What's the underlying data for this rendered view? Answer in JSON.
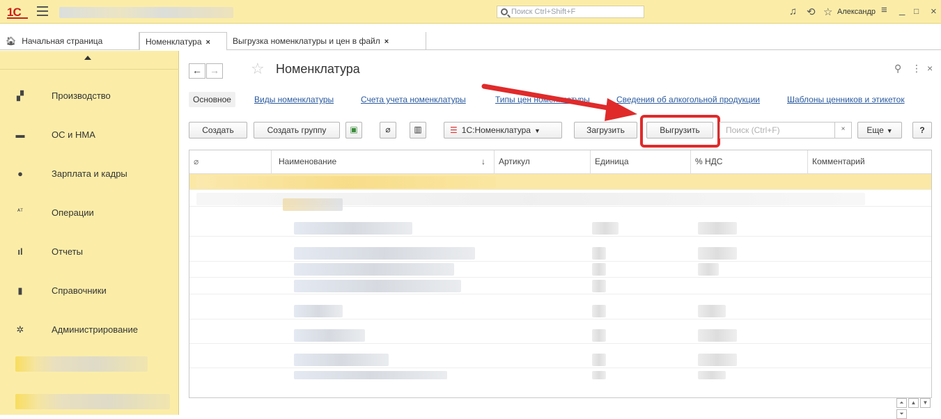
{
  "titlebar": {
    "logo": "1С",
    "search_placeholder": "Поиск Ctrl+Shift+F",
    "user": "Александр"
  },
  "tabs": [
    {
      "label": "Начальная страница"
    },
    {
      "label": "Номенклатура",
      "close": "×"
    },
    {
      "label": "Выгрузка номенклатуры и цен в файл",
      "close": "×"
    }
  ],
  "sidebar": {
    "items": [
      {
        "label": "Производство",
        "icon": "factory-icon"
      },
      {
        "label": "ОС и НМА",
        "icon": "truck-icon"
      },
      {
        "label": "Зарплата и кадры",
        "icon": "person-icon"
      },
      {
        "label": "Операции",
        "icon": "ledger-icon"
      },
      {
        "label": "Отчеты",
        "icon": "bar-chart-icon"
      },
      {
        "label": "Справочники",
        "icon": "book-icon"
      },
      {
        "label": "Администрирование",
        "icon": "gear-icon"
      }
    ]
  },
  "form": {
    "title": "Номенклатура",
    "sections": [
      "Основное",
      "Виды номенклатуры",
      "Счета учета номенклатуры",
      "Типы цен номенклатуры",
      "Сведения об алкогольной продукции",
      "Шаблоны ценников и этикеток"
    ],
    "toolbar": {
      "create": "Создать",
      "create_group": "Создать группу",
      "classifier": "1С:Номенклатура",
      "load": "Загрузить",
      "export": "Выгрузить",
      "search_placeholder": "Поиск (Ctrl+F)",
      "more": "Еще",
      "help": "?"
    }
  },
  "table": {
    "columns": [
      "Наименование",
      "Артикул",
      "Единица",
      "% НДС",
      "Комментарий"
    ],
    "sort_indicator": "↓"
  }
}
